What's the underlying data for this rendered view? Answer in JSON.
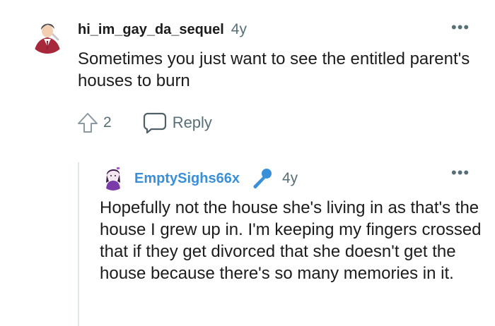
{
  "comment": {
    "username": "hi_im_gay_da_sequel",
    "age": "4y",
    "body": "Sometimes you just want to see the entitled parent's houses to burn",
    "vote_count": "2",
    "reply_label": "Reply",
    "more_label": "•••",
    "avatar_icon": "user-avatar-icon"
  },
  "reply": {
    "username": "EmptySighs66x",
    "age": "4y",
    "body": "Hopefully not the house she's living in as that's the house I grew up in. I'm keeping my fingers crossed that if they get divorced that she doesn't get the house because there's so many memories in it.",
    "more_label": "•••",
    "badge_icon": "microphone-icon",
    "avatar_icon": "user-avatar-icon",
    "username_color": "#3a8fd9"
  },
  "colors": {
    "meta_text": "#576f76",
    "body_text": "#1c1c1c",
    "thread_line": "#e2e6e8"
  }
}
